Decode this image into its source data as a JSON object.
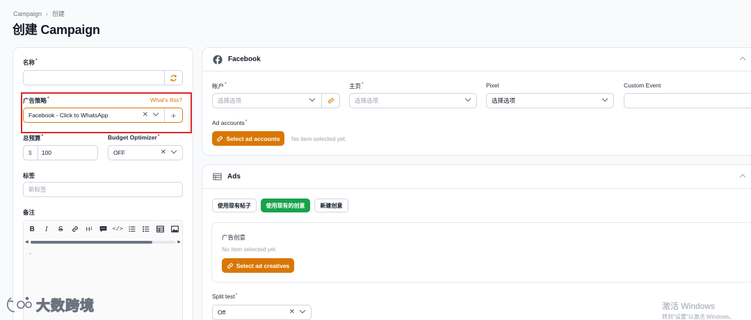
{
  "breadcrumb": {
    "root": "Campaign",
    "current": "创建"
  },
  "page_title": "创建 Campaign",
  "left": {
    "name_label": "名称",
    "name_value": "",
    "strategy_label": "广告策略",
    "strategy_help": "What's this?",
    "strategy_value": "Facebook - Click to WhatsApp",
    "budget_label": "总预算",
    "budget_currency": "$",
    "budget_value": "100",
    "optimizer_label": "Budget Optimizer",
    "optimizer_value": "OFF",
    "tags_label": "标签",
    "tags_placeholder": "新标签",
    "notes_label": "备注",
    "editor_text": "-",
    "toolbar": [
      "B",
      "I",
      "S",
      "link",
      "H1",
      "comment",
      "code",
      "bullet-list",
      "ordered-list",
      "table",
      "image"
    ]
  },
  "facebook": {
    "title": "Facebook",
    "account_label": "帐户",
    "account_placeholder": "选择选项",
    "page_label": "主页",
    "page_placeholder": "选择选项",
    "pixel_label": "Pixel",
    "pixel_value": "选择选项",
    "custom_event_label": "Custom Event",
    "ad_accounts_label": "Ad accounts",
    "select_ad_accounts": "Select ad accounts",
    "no_item": "No item selected yet."
  },
  "ads": {
    "title": "Ads",
    "tabs": [
      "使用现有帖子",
      "使用现有的创意",
      "新建创意"
    ],
    "creative_label": "广告创意",
    "no_item": "No item selected yet.",
    "select_ad_creatives": "Select ad creatives",
    "split_test_label": "Split test",
    "split_test_value": "Off"
  },
  "watermark": "大数跨境",
  "activate_windows": {
    "line1": "激活 Windows",
    "line2": "转到\"设置\"以激活 Windows。"
  },
  "colors": {
    "accent": "#d97706",
    "green": "#16a34a",
    "required": "#dc2626",
    "highlight": "#dc2626"
  }
}
